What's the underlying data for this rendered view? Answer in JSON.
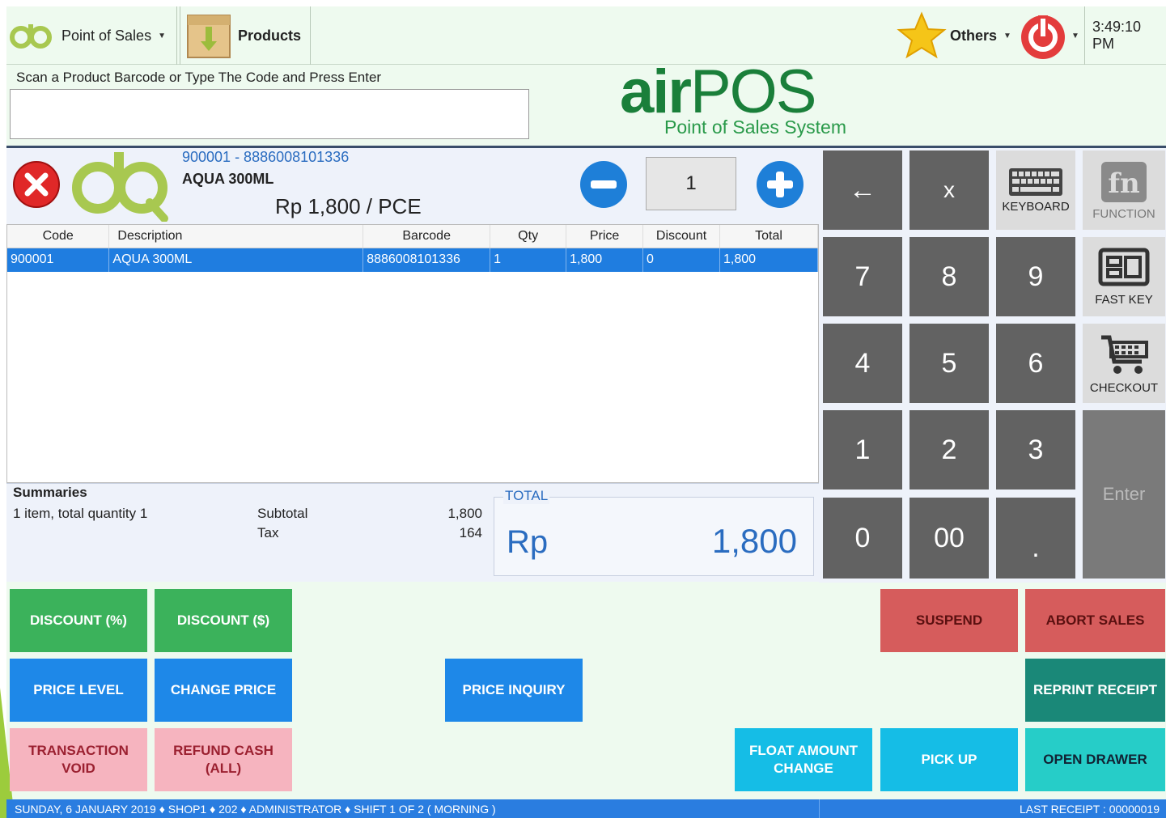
{
  "menu": {
    "point_of_sales": "Point of Sales",
    "products": "Products",
    "others": "Others",
    "clock": "3:49:10 PM"
  },
  "scan": {
    "label": "Scan a Product Barcode or Type The Code and Press Enter",
    "value": ""
  },
  "logo": {
    "brand_prefix": "air",
    "brand_suffix": "POS",
    "tagline": "Point of Sales System"
  },
  "product": {
    "code_barcode": "900001 - 8886008101336",
    "name": "AQUA 300ML",
    "price": "Rp 1,800 / PCE",
    "quantity": "1"
  },
  "table": {
    "headers": [
      "Code",
      "Description",
      "Barcode",
      "Qty",
      "Price",
      "Discount",
      "Total"
    ],
    "rows": [
      [
        "900001",
        "AQUA 300ML",
        "8886008101336",
        "1",
        "1,800",
        "0",
        "1,800"
      ]
    ]
  },
  "summary": {
    "title": "Summaries",
    "items_text": "1 item, total quantity 1",
    "subtotal_label": "Subtotal",
    "subtotal_value": "1,800",
    "tax_label": "Tax",
    "tax_value": "164",
    "total_label": "TOTAL",
    "currency": "Rp",
    "total_value": "1,800"
  },
  "keypad": {
    "backspace": "←",
    "clear": "x",
    "keyboard": "KEYBOARD",
    "function": "FUNCTION",
    "fast_key": "FAST KEY",
    "checkout": "CHECKOUT",
    "enter": "Enter",
    "k7": "7",
    "k8": "8",
    "k9": "9",
    "k4": "4",
    "k5": "5",
    "k6": "6",
    "k1": "1",
    "k2": "2",
    "k3": "3",
    "k0": "0",
    "k00": "00",
    "kdot": "."
  },
  "actions": {
    "discount_pct": "DISCOUNT (%)",
    "discount_amt": "DISCOUNT ($)",
    "suspend": "SUSPEND",
    "abort_sales": "ABORT SALES",
    "price_level": "PRICE LEVEL",
    "change_price": "CHANGE PRICE",
    "price_inquiry": "PRICE INQUIRY",
    "reprint_receipt": "REPRINT RECEIPT",
    "transaction_void_1": "TRANSACTION",
    "transaction_void_2": "VOID",
    "refund_cash_1": "REFUND CASH",
    "refund_cash_2": "(ALL)",
    "float_amount_1": "FLOAT AMOUNT",
    "float_amount_2": "CHANGE",
    "pick_up": "PICK UP",
    "open_drawer": "OPEN DRAWER"
  },
  "status": {
    "left": "SUNDAY, 6 JANUARY 2019 ♦ SHOP1 ♦ 202 ♦ ADMINISTRATOR ♦ SHIFT 1 OF 2 ( MORNING )",
    "right": "LAST RECEIPT : 00000019"
  },
  "colors": {
    "brand_green": "#1a7f3a",
    "accent_blue": "#2a6cc0",
    "selected_row": "#1f7de0",
    "key_dark": "#626262"
  },
  "icons": [
    "airpos-logo-icon",
    "box-icon",
    "star-icon",
    "power-icon",
    "close-icon",
    "minus-icon",
    "plus-icon",
    "keyboard-icon",
    "function-icon",
    "fast-key-icon",
    "cart-icon"
  ]
}
